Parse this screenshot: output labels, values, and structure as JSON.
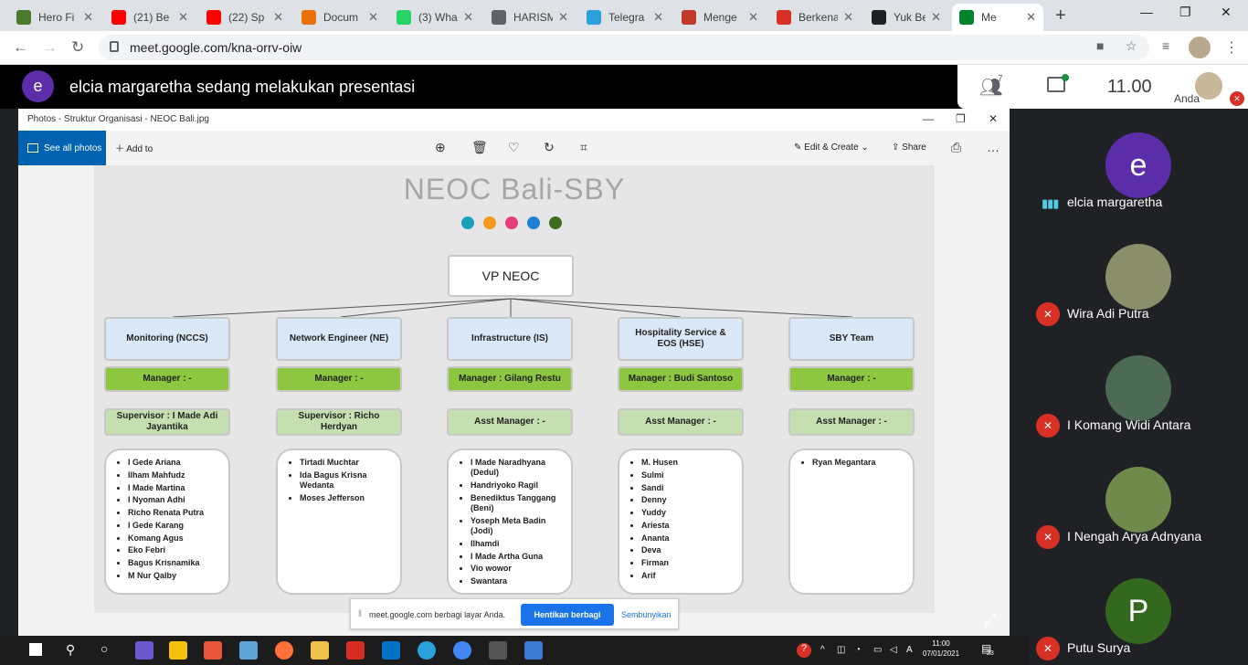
{
  "browser": {
    "tabs": [
      {
        "title": "Hero Fi",
        "icon": "game-icon",
        "color": "#4a7a2c"
      },
      {
        "title": "(21) Be",
        "icon": "youtube-icon",
        "color": "#ff0000"
      },
      {
        "title": "(22) Sp",
        "icon": "youtube-icon",
        "color": "#ff0000"
      },
      {
        "title": "Docum",
        "icon": "document-icon",
        "color": "#e8710a"
      },
      {
        "title": "(3) Wha",
        "icon": "whatsapp-icon",
        "color": "#25d366"
      },
      {
        "title": "HARISM",
        "icon": "globe-icon",
        "color": "#5f6368"
      },
      {
        "title": "Telegra",
        "icon": "telegram-icon",
        "color": "#2aa1da"
      },
      {
        "title": "Menge",
        "icon": "site-icon",
        "color": "#c0392b"
      },
      {
        "title": "Berkena",
        "icon": "site-icon",
        "color": "#d93025"
      },
      {
        "title": "Yuk Bel",
        "icon": "m-icon",
        "color": "#202124"
      },
      {
        "title": "Me",
        "icon": "meet-icon",
        "color": "#00832d"
      }
    ],
    "url": "meet.google.com/kna-orrv-oiw"
  },
  "meet": {
    "presenter_initial": "e",
    "presenter_text": "elcia margaretha sedang melakukan presentasi",
    "people_count": "7",
    "clock": "11.00",
    "self_label": "Anda"
  },
  "photos": {
    "window_title": "Photos - Struktur Organisasi - NEOC Bali.jpg",
    "see_all": "See all photos",
    "add_to": "Add to",
    "edit_create": "Edit & Create",
    "share": "Share"
  },
  "org": {
    "title": "NEOC Bali-SBY",
    "dot_colors": [
      "#1a9fb5",
      "#f39a1e",
      "#e93d7a",
      "#1f7fd1",
      "#3d6b1f"
    ],
    "top": "VP NEOC",
    "departments": [
      {
        "name": "Monitoring (NCCS)",
        "manager": "Manager : -",
        "second": "Supervisor : I Made Adi Jayantika",
        "members": [
          "I Gede Ariana",
          "Ilham Mahfudz",
          "I Made Martina",
          "I Nyoman Adhi",
          "Richo Renata Putra",
          "I Gede Karang",
          "Komang Agus",
          "Eko Febri",
          "Bagus Krisnamika",
          "M Nur Qalby"
        ]
      },
      {
        "name": "Network Engineer (NE)",
        "manager": "Manager : -",
        "second": "Supervisor : Richo Herdyan",
        "members": [
          "Tirtadi Muchtar",
          "Ida Bagus Krisna Wedanta",
          "Moses Jefferson"
        ]
      },
      {
        "name": "Infrastructure (IS)",
        "manager": "Manager : Gilang Restu",
        "second": "Asst Manager : -",
        "members": [
          "I Made Naradhyana (Dedul)",
          "Handriyoko Ragil",
          "Benediktus Tanggang (Beni)",
          "Yoseph Meta Badin (Jodi)",
          "Ilhamdi",
          "I Made Artha Guna",
          "Vio wowor",
          "Swantara"
        ]
      },
      {
        "name": "Hospitality Service & EOS (HSE)",
        "manager": "Manager : Budi Santoso",
        "second": "Asst Manager : -",
        "members": [
          "M. Husen",
          "Sulmi",
          "Sandi",
          "Denny",
          "Yuddy",
          "Ariesta",
          "Ananta",
          "Deva",
          "Firman",
          "Arif"
        ]
      },
      {
        "name": "SBY Team",
        "manager": "Manager : -",
        "second": "Asst Manager : -",
        "members": [
          "Ryan Megantara"
        ]
      }
    ]
  },
  "share_notice": {
    "message": "meet.google.com berbagi layar Anda.",
    "stop": "Hentikan berbagi",
    "hide": "Sembunyikan"
  },
  "taskbar": {
    "time": "11:00",
    "date": "07/01/2021",
    "notif_count": "23"
  },
  "participants": [
    {
      "name": "elcia margaretha",
      "initial": "e",
      "color": "#5b2da8",
      "status": "speaking"
    },
    {
      "name": "Wira Adi Putra",
      "initial": "",
      "color": "#8a8f6a",
      "status": "muted"
    },
    {
      "name": "I Komang Widi Antara",
      "initial": "",
      "color": "#4d6a55",
      "status": "muted"
    },
    {
      "name": "I Nengah Arya Adnyana",
      "initial": "",
      "color": "#6f8a4a",
      "status": "muted"
    },
    {
      "name": "Putu Surya",
      "initial": "P",
      "color": "#33691e",
      "status": "muted"
    }
  ]
}
